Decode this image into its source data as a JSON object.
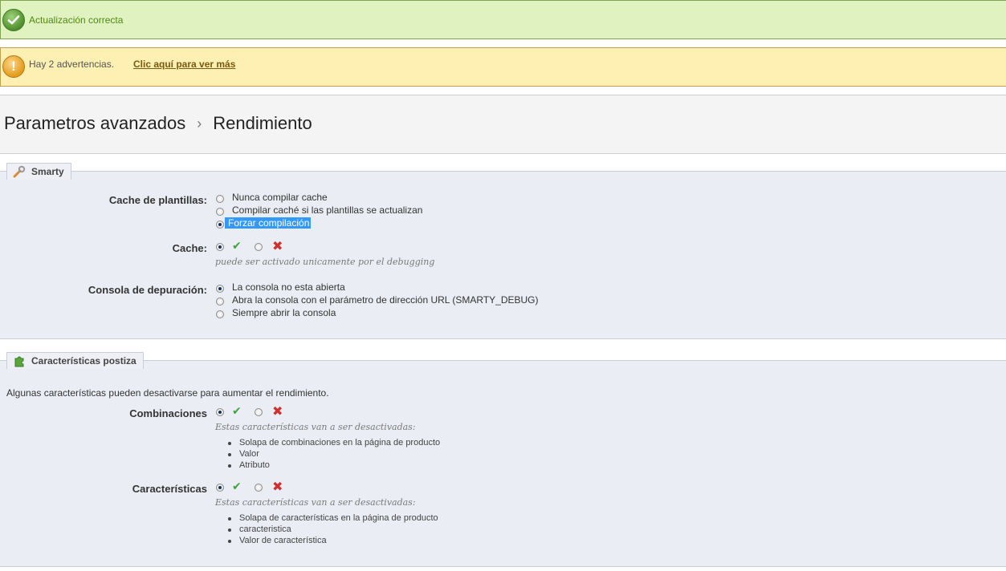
{
  "notifications": {
    "success": {
      "text": "Actualización correcta",
      "icon": "check-circle-icon",
      "color": "#4f8a10"
    },
    "warning": {
      "text": "Hay 2 advertencias.",
      "link": "Clic aquí para ver más",
      "icon": "exclamation-circle-icon"
    }
  },
  "header": {
    "breadcrumb": [
      "Parametros avanzados",
      "Rendimiento"
    ],
    "separator": "›"
  },
  "smarty": {
    "legend": "Smarty",
    "legend_icon": "wrench-icon",
    "cache_templates": {
      "label": "Cache de plantillas:",
      "options": [
        "Nunca compilar cache",
        "Compilar caché si las plantillas se actualizan",
        "Forzar compilación"
      ],
      "selected": "Forzar compilación"
    },
    "cache": {
      "label": "Cache:",
      "selected": "yes",
      "hint": "puede ser activado unicamente por el debugging"
    },
    "debug_console": {
      "label": "Consola de depuración:",
      "options": [
        "La consola no esta abierta",
        "Abra la consola con el parámetro de dirección URL (SMARTY_DEBUG)",
        "Siempre abrir la consola"
      ],
      "selected": "La consola no esta abierta"
    }
  },
  "features": {
    "legend": "Características postiza",
    "legend_icon": "puzzle-icon",
    "intro": "Algunas características pueden desactivarse para aumentar el rendimiento.",
    "combinations": {
      "label": "Combinaciones",
      "selected": "yes",
      "hint": "Estas características van a ser desactivadas:",
      "items": [
        "Solapa de combinaciones en la página de producto",
        "Valor",
        "Atributo"
      ]
    },
    "characteristics": {
      "label": "Características",
      "selected": "yes",
      "hint": "Estas características van a ser desactivadas:",
      "items": [
        "Solapa de características en la página de producto",
        "caracteristica",
        "Valor de característica"
      ]
    }
  },
  "colors": {
    "success_bg": "#dff2bf",
    "warning_bg": "#feefb3",
    "panel_bg": "#ebedf4",
    "selection": "#3399ff"
  }
}
